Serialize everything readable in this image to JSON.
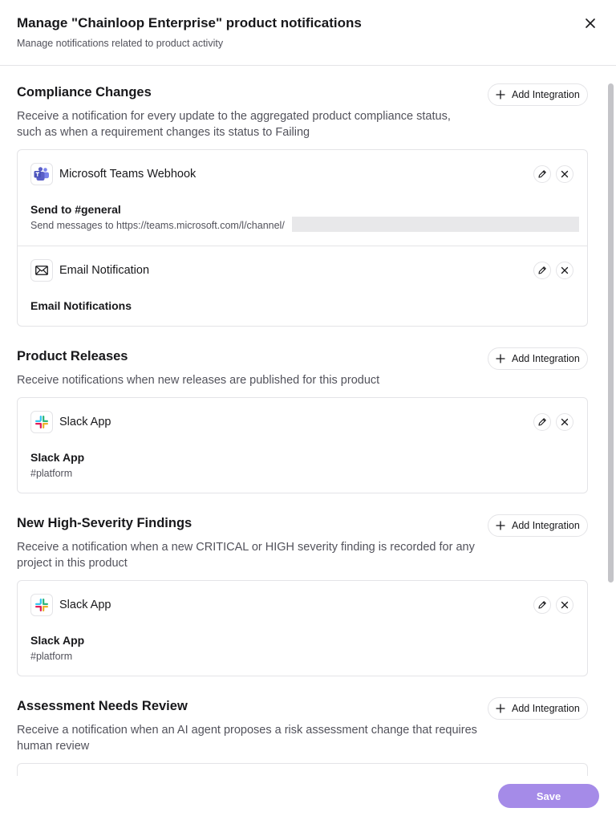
{
  "dialog": {
    "title": "Manage \"Chainloop Enterprise\" product notifications",
    "subtitle": "Manage notifications related to product activity",
    "close_icon": "close-icon"
  },
  "add_integration_label": "Add Integration",
  "sections": [
    {
      "title": "Compliance Changes",
      "description": "Receive a notification for every update to the aggregated product compliance status, such as when a requirement changes its status to Failing",
      "integrations": [
        {
          "icon": "microsoft-teams-icon",
          "name": "Microsoft Teams Webhook",
          "target": "Send to #general",
          "detail": "Send messages to https://teams.microsoft.com/l/channel/"
        },
        {
          "icon": "mail-icon",
          "name": "Email Notification",
          "target": "Email Notifications",
          "detail": ""
        }
      ]
    },
    {
      "title": "Product Releases",
      "description": "Receive notifications when new releases are published for this product",
      "integrations": [
        {
          "icon": "slack-icon",
          "name": "Slack App",
          "target": "Slack App",
          "detail": "#platform"
        }
      ]
    },
    {
      "title": "New High-Severity Findings",
      "description": "Receive a notification when a new CRITICAL or HIGH severity finding is recorded for any project in this product",
      "integrations": [
        {
          "icon": "slack-icon",
          "name": "Slack App",
          "target": "Slack App",
          "detail": "#platform"
        }
      ]
    },
    {
      "title": "Assessment Needs Review",
      "description": "Receive a notification when an AI agent proposes a risk assessment change that requires human review",
      "integrations": []
    }
  ],
  "footer": {
    "save_label": "Save"
  },
  "colors": {
    "accent": "#a58be8",
    "border": "#e4e4e7",
    "muted_text": "#52525b",
    "teams_purple": "#5b5fc7",
    "slack_green": "#2eb67d",
    "slack_blue": "#36c5f0",
    "slack_red": "#e01e5a",
    "slack_yellow": "#ecb22e"
  }
}
